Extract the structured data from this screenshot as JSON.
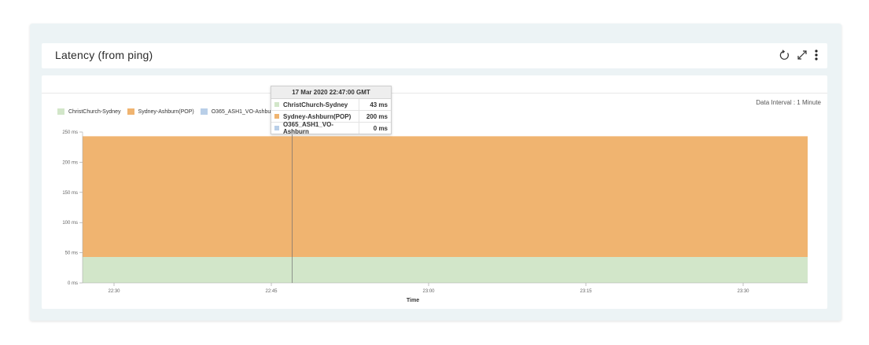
{
  "widget": {
    "title": "Latency (from ping)",
    "data_interval": "Data Interval : 1 Minute",
    "icons": [
      "refresh-icon",
      "expand-icon",
      "more-vertical-icon"
    ]
  },
  "legend": [
    {
      "name": "ChristChurch-Sydney",
      "color": "#d2e6c9"
    },
    {
      "name": "Sydney-Ashburn(POP)",
      "color": "#f0b470"
    },
    {
      "name": "O365_ASH1_VO-Ashburn",
      "color": "#b9cfe8"
    }
  ],
  "tooltip": {
    "timestamp": "17 Mar 2020 22:47:00 GMT",
    "rows": [
      {
        "name": "ChristChurch-Sydney",
        "value": "43 ms",
        "color": "#d2e6c9"
      },
      {
        "name": "Sydney-Ashburn(POP)",
        "value": "200 ms",
        "color": "#f0b470"
      },
      {
        "name": "O365_ASH1_VO-Ashburn",
        "value": "0 ms",
        "color": "#b9cfe8"
      }
    ]
  },
  "chart_data": {
    "type": "area",
    "stacked": true,
    "x": [
      "22:25",
      "22:30",
      "22:35",
      "22:40",
      "22:45",
      "22:50",
      "22:55",
      "23:00",
      "23:05",
      "23:10",
      "23:15",
      "23:20",
      "23:25",
      "23:30",
      "23:35"
    ],
    "xticks": [
      "22:30",
      "22:45",
      "23:00",
      "23:15",
      "23:30"
    ],
    "xlabel": "Time",
    "ylabel": "",
    "ylim": [
      0,
      250
    ],
    "yticks": [
      "0 ms",
      "50 ms",
      "100 ms",
      "150 ms",
      "200 ms",
      "250 ms"
    ],
    "series": [
      {
        "name": "ChristChurch-Sydney",
        "color": "#d2e6c9",
        "values": [
          43,
          43,
          43,
          43,
          43,
          43,
          43,
          43,
          43,
          43,
          43,
          43,
          43,
          43,
          43
        ]
      },
      {
        "name": "Sydney-Ashburn(POP)",
        "color": "#f0b470",
        "values": [
          200,
          200,
          200,
          200,
          200,
          200,
          200,
          200,
          200,
          200,
          200,
          200,
          200,
          200,
          200
        ]
      },
      {
        "name": "O365_ASH1_VO-Ashburn",
        "color": "#b9cfe8",
        "values": [
          0,
          0,
          0,
          0,
          0,
          0,
          0,
          0,
          0,
          0,
          0,
          0,
          0,
          0,
          0
        ]
      }
    ],
    "crosshair_x": "22:47",
    "grid": false,
    "legend_position": "top-left"
  }
}
